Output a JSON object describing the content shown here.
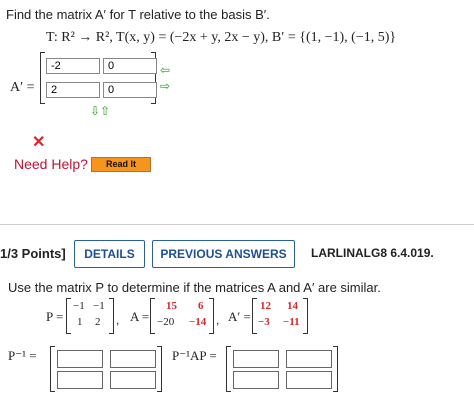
{
  "q1": {
    "prompt": "Find the matrix A′ for T relative to the basis B′.",
    "mapping": "T: R² → R², T(x, y) = (−2x + y, 2x − y), B′ = {(1, −1), (−1, 5)}",
    "label": "A′ =",
    "entries": [
      "-2",
      "0",
      "2",
      "0"
    ],
    "need_help": "Need Help?",
    "read_it": "Read It"
  },
  "q2": {
    "points": "1/3 Points]",
    "details": "DETAILS",
    "previous_answers": "PREVIOUS ANSWERS",
    "code": "LARLINALG8 6.4.019.",
    "prompt": "Use the matrix P to determine if the matrices A and A′ are similar.",
    "P_label": "P =",
    "P": [
      "−1",
      "−1",
      "1",
      "2"
    ],
    "A_label": "A =",
    "A": [
      "15",
      "6",
      "−20",
      "−14"
    ],
    "Aprime_label": "A′ =",
    "Aprime": [
      "12",
      "14",
      "−3",
      "−11"
    ],
    "Pinv_label": "P⁻¹ =",
    "PinvAP_label": "P⁻¹AP ="
  },
  "colors": {
    "accent": "#2a5fa5",
    "error": "#d9262b",
    "help": "#c8102e",
    "readit": "#f7941d",
    "matrix_red": "#d9262b"
  }
}
